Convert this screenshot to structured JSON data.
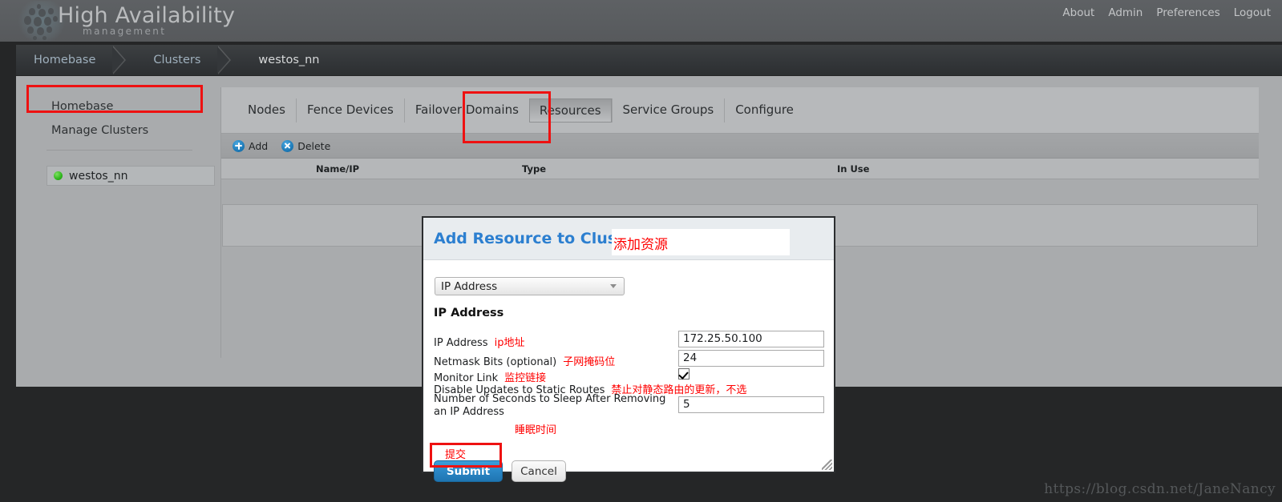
{
  "header": {
    "brand_title": "High Availability",
    "brand_subtitle": "management",
    "nav": [
      {
        "label": "About"
      },
      {
        "label": "Admin"
      },
      {
        "label": "Preferences"
      },
      {
        "label": "Logout"
      }
    ]
  },
  "breadcrumb": {
    "items": [
      {
        "label": "Homebase"
      },
      {
        "label": "Clusters"
      },
      {
        "label": "westos_nn"
      }
    ]
  },
  "sidebar": {
    "links": [
      {
        "label": "Homebase"
      },
      {
        "label": "Manage Clusters"
      }
    ],
    "cluster": {
      "label": "westos_nn",
      "status_color": "#2fb71d"
    }
  },
  "panel": {
    "tabs": [
      {
        "label": "Nodes",
        "active": false
      },
      {
        "label": "Fence Devices",
        "active": false
      },
      {
        "label": "Failover Domains",
        "active": false
      },
      {
        "label": "Resources",
        "active": true
      },
      {
        "label": "Service Groups",
        "active": false
      },
      {
        "label": "Configure",
        "active": false
      }
    ],
    "toolbar": {
      "add_label": "Add",
      "delete_label": "Delete"
    },
    "table": {
      "columns": [
        "Name/IP",
        "Type",
        "In Use"
      ],
      "rows": []
    }
  },
  "modal": {
    "title": "Add Resource to Cluster",
    "title_annotation_cn": "添加资源",
    "resource_type_selected": "IP Address",
    "section_title": "IP Address",
    "fields": {
      "ip_address": {
        "label": "IP Address",
        "annotation_cn": "ip地址",
        "value": "172.25.50.100"
      },
      "netmask_bits": {
        "label": "Netmask Bits (optional)",
        "annotation_cn": "子网掩码位",
        "value": "24"
      },
      "monitor_link": {
        "label": "Monitor Link",
        "annotation_cn": "监控链接",
        "checked": true
      },
      "disable_updates": {
        "label": "Disable Updates to Static Routes",
        "annotation_cn": "禁止对静态路由的更新，不选",
        "checked": false
      },
      "sleep_seconds": {
        "label": "Number of Seconds to Sleep After Removing an IP Address",
        "annotation_cn": "睡眠时间",
        "value": "5"
      }
    },
    "submit_annotation_cn": "提交",
    "buttons": {
      "submit": "Submit",
      "cancel": "Cancel"
    }
  },
  "watermark": "https://blog.csdn.net/JaneNancy",
  "colors": {
    "accent_blue": "#2c7fd0",
    "annotation_red": "#ff0000",
    "highlight_box_red": "#ee1111",
    "status_green": "#2fb71d"
  }
}
